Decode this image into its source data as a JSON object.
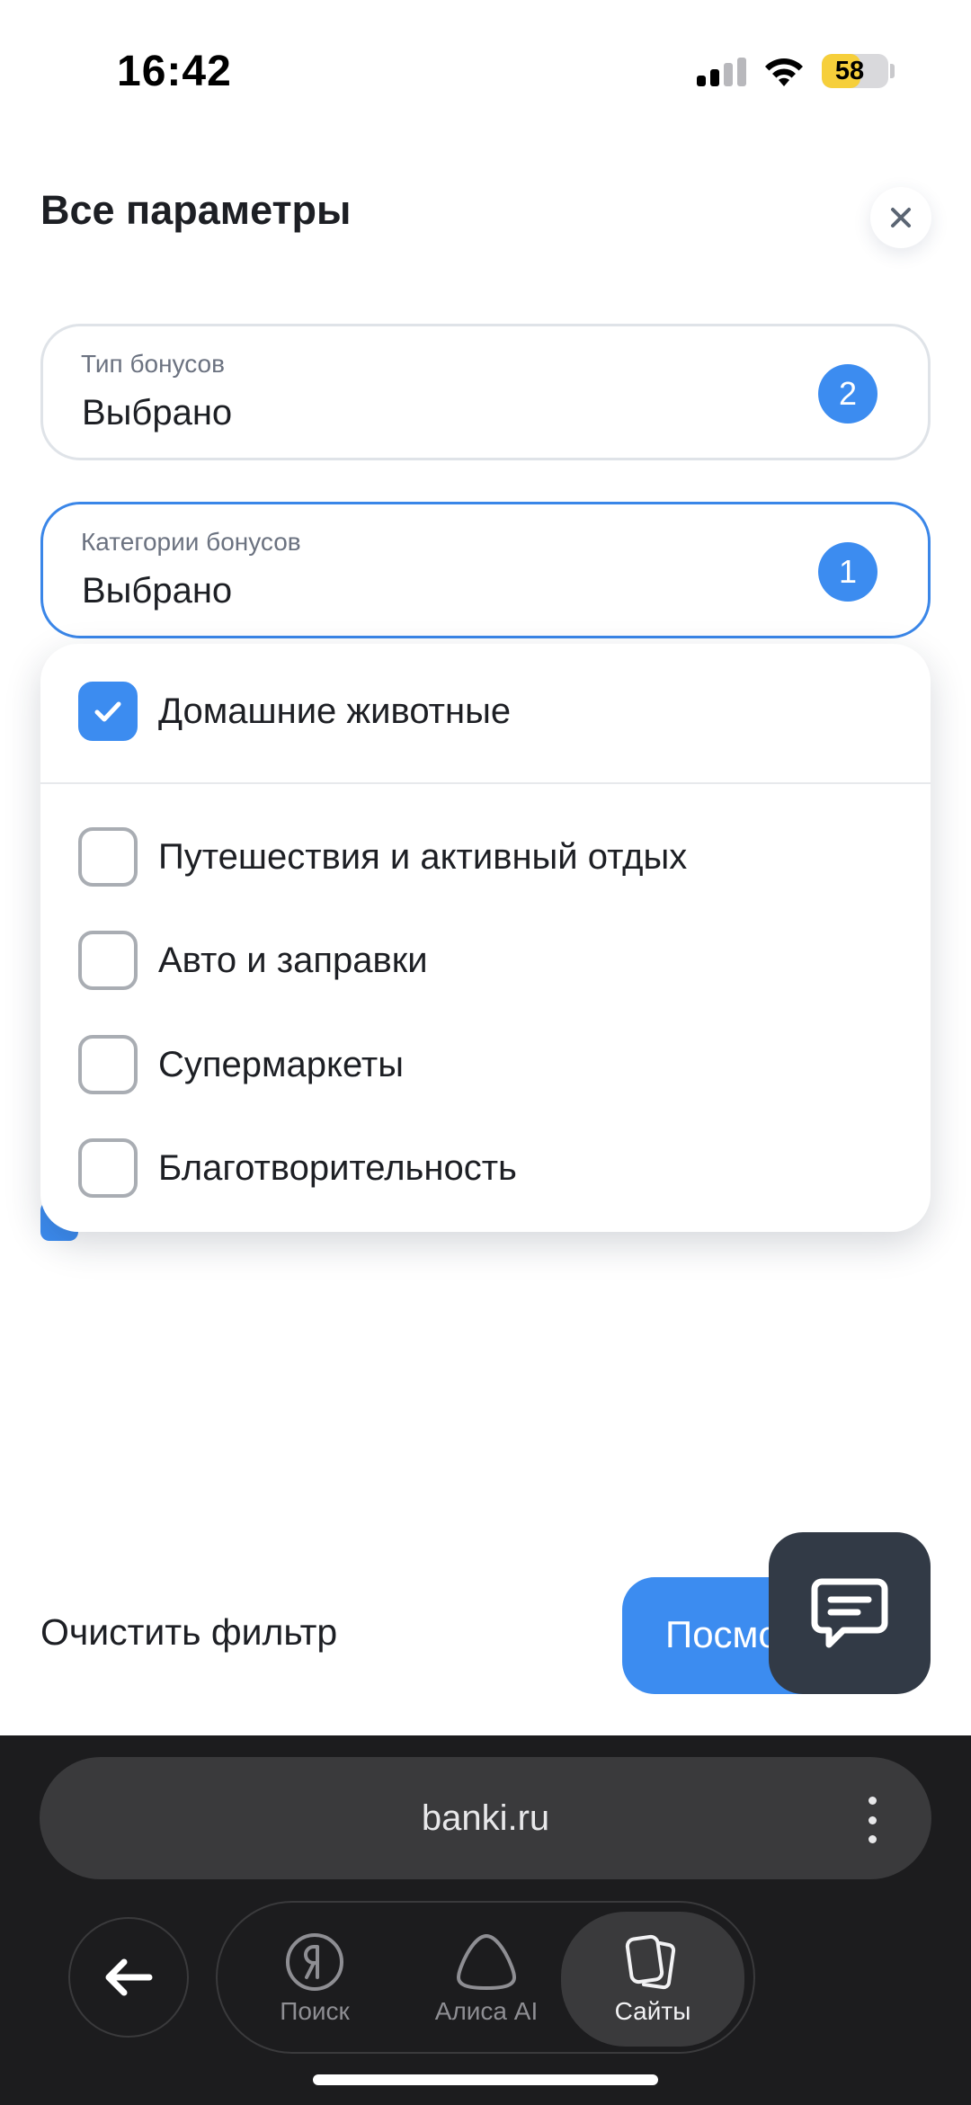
{
  "status_bar": {
    "time": "16:42",
    "battery": "58",
    "battery_level": 0.58
  },
  "header": {
    "title": "Все параметры"
  },
  "filters": [
    {
      "label": "Тип бонусов",
      "value": "Выбрано",
      "count": "2"
    },
    {
      "label": "Категории бонусов",
      "value": "Выбрано",
      "count": "1"
    }
  ],
  "dropdown": {
    "options": [
      {
        "label": "Домашние животные",
        "checked": true
      },
      {
        "label": "Путешествия и активный отдых",
        "checked": false
      },
      {
        "label": "Авто и заправки",
        "checked": false
      },
      {
        "label": "Супермаркеты",
        "checked": false
      },
      {
        "label": "Благотворительность",
        "checked": false
      }
    ]
  },
  "footer": {
    "clear_label": "Очистить фильтр",
    "show_label": "Посмо"
  },
  "browser": {
    "url": "banki.ru",
    "nav": [
      {
        "label": "Поиск"
      },
      {
        "label": "Алиса AI"
      },
      {
        "label": "Сайты"
      }
    ]
  },
  "colors": {
    "accent": "#3c8cf0",
    "chat_button": "#323a46",
    "browser_bg": "#1c1c1e"
  }
}
